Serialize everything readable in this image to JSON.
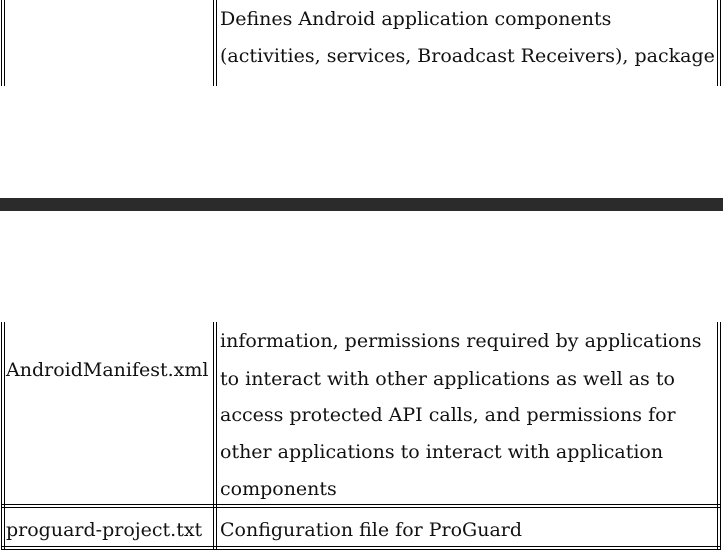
{
  "top_fragment": {
    "description_lines": [
      "Defines Android application components",
      "(activities, services, Broadcast Receivers), package"
    ]
  },
  "bottom_fragment": {
    "rows": [
      {
        "file": "AndroidManifest.xml",
        "description_lines": [
          "information, permissions required by applications",
          "to interact with other applications as well as to",
          "access protected API calls, and permissions for",
          "other applications to interact with application",
          "components"
        ]
      },
      {
        "file": "proguard-project.txt",
        "description_lines": [
          "Configuration file for ProGuard"
        ]
      }
    ]
  }
}
